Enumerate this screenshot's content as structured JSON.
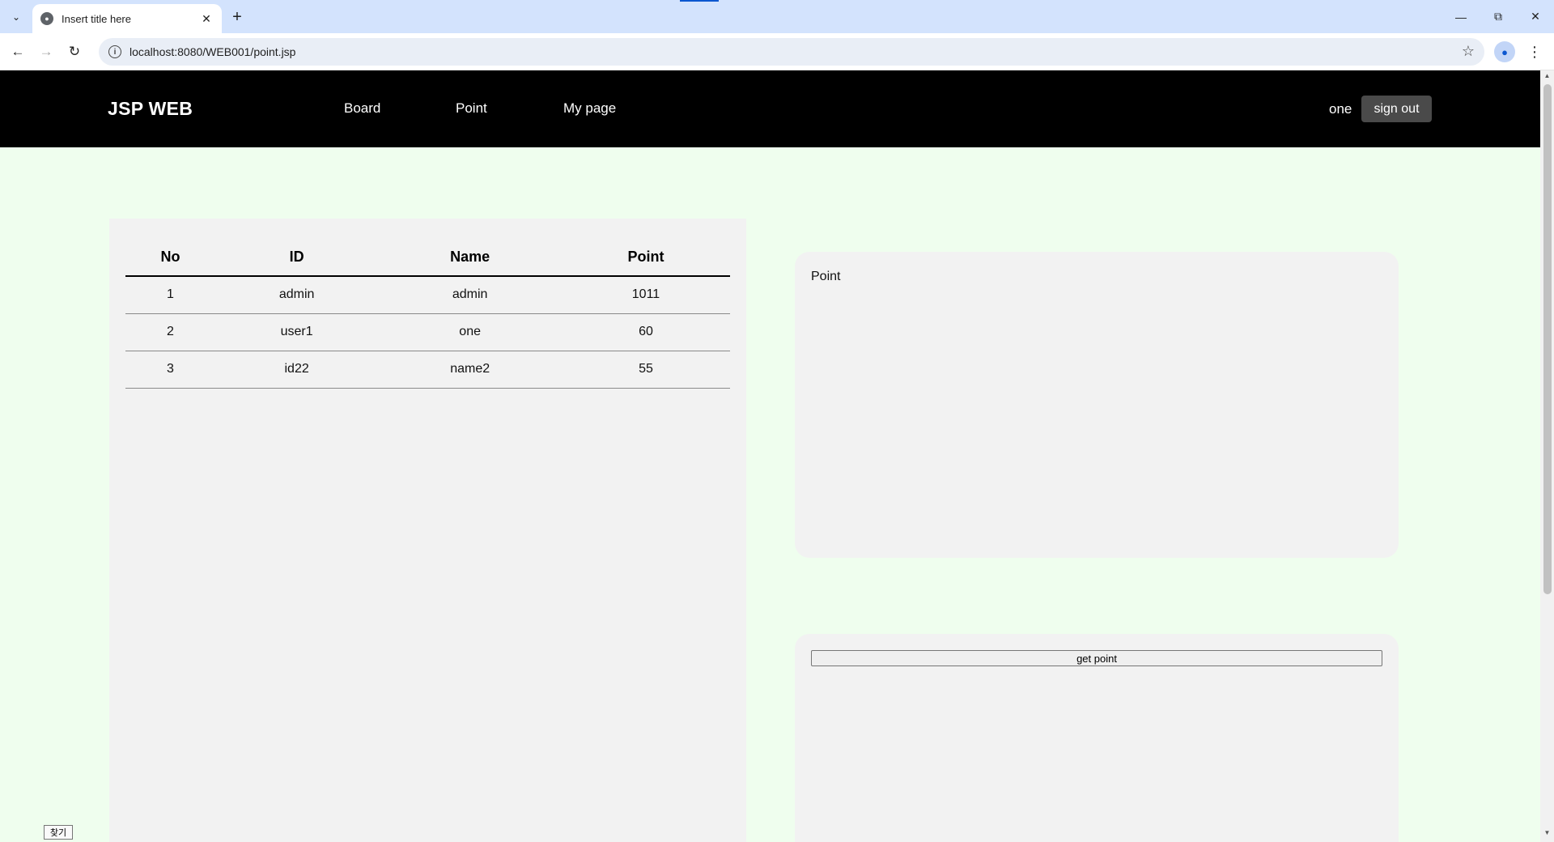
{
  "browser": {
    "tab_title": "Insert title here",
    "new_tab_symbol": "+",
    "url": "localhost:8080/WEB001/point.jsp",
    "icons": {
      "tab_search": "chevron-down-icon",
      "favicon": "globe-icon",
      "tab_close": "close-icon",
      "back": "arrow-left-icon",
      "forward": "arrow-right-icon",
      "reload": "reload-icon",
      "site_info": "info-icon",
      "bookmark": "star-icon",
      "profile": "person-icon",
      "menu": "kebab-menu-icon",
      "minimize": "minimize-icon",
      "restore": "restore-icon",
      "close_window": "close-icon"
    }
  },
  "site": {
    "brand": "JSP WEB",
    "nav": {
      "board": "Board",
      "point": "Point",
      "mypage": "My page"
    },
    "user_name": "one",
    "signout_label": "sign out"
  },
  "points_table": {
    "headers": {
      "no": "No",
      "id": "ID",
      "name": "Name",
      "point": "Point"
    },
    "rows": [
      {
        "no": "1",
        "id": "admin",
        "name": "admin",
        "point": "1011"
      },
      {
        "no": "2",
        "id": "user1",
        "name": "one",
        "point": "60"
      },
      {
        "no": "3",
        "id": "id22",
        "name": "name2",
        "point": "55"
      }
    ]
  },
  "point_card": {
    "title": "Point"
  },
  "get_point_card": {
    "button_label": "get point"
  },
  "find_button_label": "찾기",
  "colors": {
    "page_background": "#effeee",
    "navbar": "#000000",
    "panel": "#f2f2f2",
    "signout_button": "#4a4a4a",
    "tabstrip": "#d3e3fd"
  }
}
